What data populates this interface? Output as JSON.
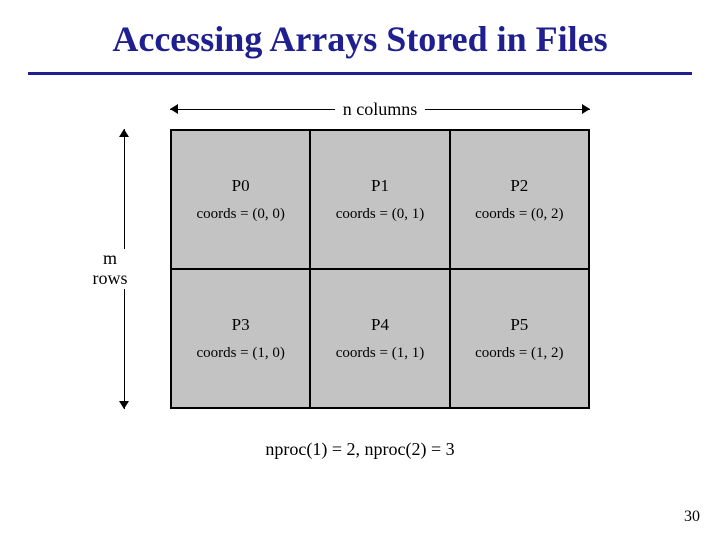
{
  "title": "Accessing Arrays Stored in Files",
  "columns_label": "n columns",
  "rows_label_line1": "m",
  "rows_label_line2": "rows",
  "grid": {
    "cells": [
      {
        "proc": "P0",
        "coords": "coords = (0, 0)"
      },
      {
        "proc": "P1",
        "coords": "coords = (0, 1)"
      },
      {
        "proc": "P2",
        "coords": "coords = (0, 2)"
      },
      {
        "proc": "P3",
        "coords": "coords = (1, 0)"
      },
      {
        "proc": "P4",
        "coords": "coords = (1, 1)"
      },
      {
        "proc": "P5",
        "coords": "coords = (1, 2)"
      }
    ]
  },
  "footer": "nproc(1) = 2,  nproc(2) = 3",
  "page_number": "30"
}
